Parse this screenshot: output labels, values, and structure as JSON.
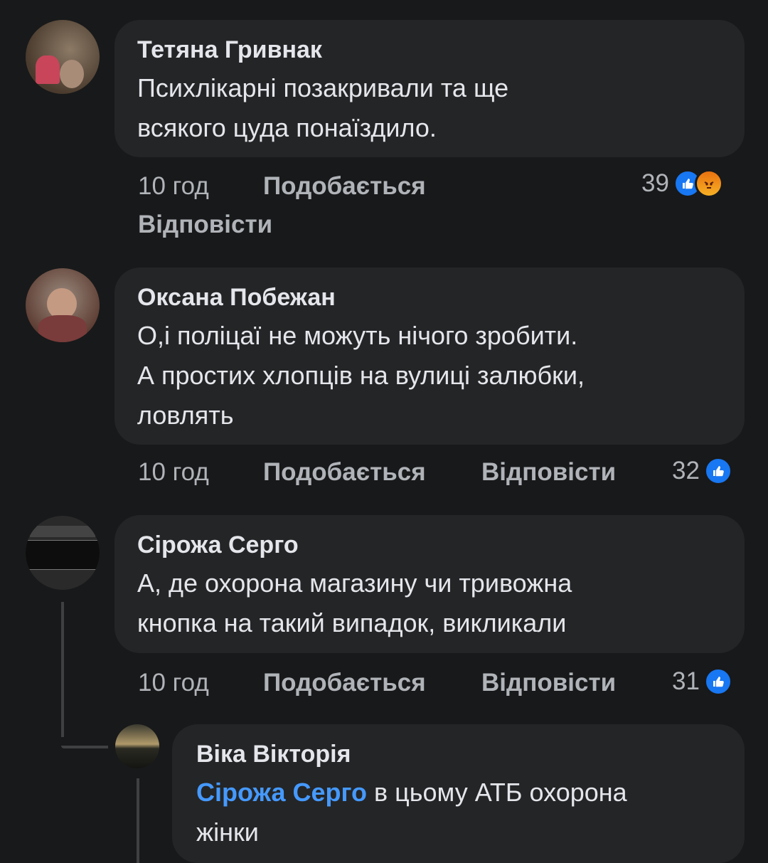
{
  "comments": [
    {
      "author": "Тетяна Гривнак",
      "text_lines": [
        "Психлікарні позакривали та ще",
        "всякого цуда понаїздило."
      ],
      "time": "10 год",
      "like_label": "Подобається",
      "reply_label": "Відповісти",
      "reaction_count": "39",
      "reactions": [
        "like-icon",
        "angry-icon"
      ]
    },
    {
      "author": "Оксана Побежан",
      "text_lines": [
        "О,і поліцаї не можуть нічого зробити.",
        "А простих хлопців на вулиці залюбки,",
        "ловлять"
      ],
      "time": "10 год",
      "like_label": "Подобається",
      "reply_label": "Відповісти",
      "reaction_count": "32",
      "reactions": [
        "like-icon"
      ]
    },
    {
      "author": "Сірожа Серго",
      "text_lines": [
        "А, де охорона магазину чи тривожна",
        "кнопка на такий випадок, викликали"
      ],
      "time": "10 год",
      "like_label": "Подобається",
      "reply_label": "Відповісти",
      "reaction_count": "31",
      "reactions": [
        "like-icon"
      ]
    }
  ],
  "reply": {
    "author": "Віка Вікторія",
    "mention": "Сірожа Серго",
    "text_line1_rest": " в цьому АТБ охорона",
    "text_line2": "жінки"
  },
  "colors": {
    "background": "#18191a",
    "bubble": "#242526",
    "mention": "#4599ff",
    "like": "#1877f2"
  }
}
